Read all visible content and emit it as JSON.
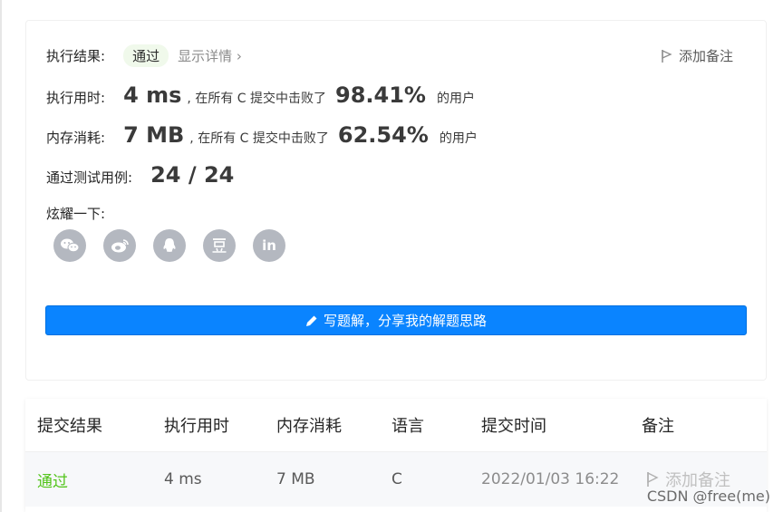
{
  "result": {
    "label": "执行结果:",
    "status": "通过",
    "detail_link": "显示详情 ›",
    "add_note": "添加备注"
  },
  "runtime": {
    "label": "执行用时:",
    "value": "4 ms",
    "prefix": ", 在所有 C 提交中击败了",
    "percent": "98.41%",
    "suffix": "的用户"
  },
  "memory": {
    "label": "内存消耗:",
    "value": "7 MB",
    "prefix": ", 在所有 C 提交中击败了",
    "percent": "62.54%",
    "suffix": "的用户"
  },
  "tests": {
    "label": "通过测试用例:",
    "value": "24 / 24"
  },
  "share": {
    "label": "炫耀一下:",
    "icons": [
      "wechat-icon",
      "weibo-icon",
      "qq-icon",
      "douban-icon",
      "linkedin-icon"
    ]
  },
  "solution_button": "写题解，分享我的解题思路",
  "table": {
    "headers": [
      "提交结果",
      "执行用时",
      "内存消耗",
      "语言",
      "提交时间",
      "备注"
    ],
    "row": {
      "result": "通过",
      "runtime": "4 ms",
      "memory": "7 MB",
      "language": "C",
      "time": "2022/01/03 16:22",
      "note": "添加备注"
    }
  },
  "watermark": "CSDN @free(me)",
  "colors": {
    "accent": "#0a84ff",
    "pass": "#52c41a",
    "icon_gray": "#b4b8c0"
  }
}
